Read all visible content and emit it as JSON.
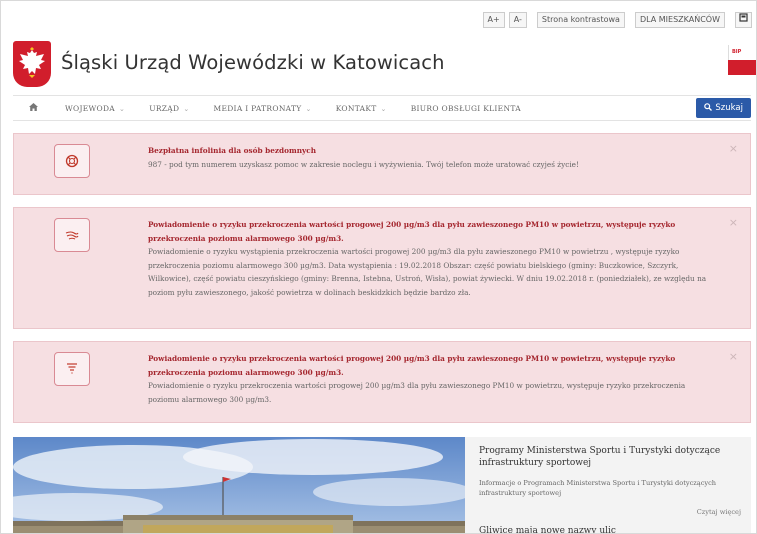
{
  "utility": {
    "font_increase": "A+",
    "font_decrease": "A-",
    "contrast_label": "Strona kontrastowa",
    "residents_label": "DLA MIESZKAŃCÓW",
    "extra_icon": "square-icon"
  },
  "header": {
    "site_title": "Śląski Urząd Wojewódzki w Katowicach",
    "crest_icon": "white-eagle-emblem-icon",
    "badge_text": "BIP"
  },
  "nav": {
    "home_icon": "home-icon",
    "items": [
      {
        "label": "WOJEWODA"
      },
      {
        "label": "URZĄD"
      },
      {
        "label": "MEDIA I PATRONATY"
      },
      {
        "label": "KONTAKT"
      },
      {
        "label": "BIURO OBSŁUGI KLIENTA"
      }
    ],
    "search_label": "Szukaj"
  },
  "alerts": [
    {
      "icon": "lifebuoy-icon",
      "title": "Bezpłatna infolinia dla osób bezdomnych",
      "body": "987 - pod tym numerem uzyskasz pomoc w zakresie noclegu i wyżywienia. Twój telefon może uratować czyjeś życie!"
    },
    {
      "icon": "wind-smog-icon",
      "title": "Powiadomienie o ryzyku przekroczenia wartości progowej 200 µg/m3 dla pyłu zawieszonego PM10 w powietrzu, występuje ryzyko przekroczenia poziomu alarmowego 300 µg/m3.",
      "body": "Powiadomienie o ryzyku wystąpienia przekroczenia wartości progowej 200 µg/m3 dla pyłu zawieszonego PM10 w powietrzu , występuje ryzyko przekroczenia poziomu alarmowego 300 µg/m3. Data wystąpienia : 19.02.2018 Obszar: część powiatu bielskiego (gminy: Buczkowice, Szczyrk, Wilkowice), część powiatu cieszyńskiego (gminy: Brenna, Istebna, Ustroń, Wisła), powiat żywiecki. W dniu 19.02.2018 r. (poniedziałek), ze względu na poziom pyłu zawieszonego, jakość powietrza w dolinach beskidzkich będzie bardzo zła."
    },
    {
      "icon": "filter-icon",
      "title": "Powiadomienie o ryzyku przekroczenia wartości progowej 200 µg/m3 dla pyłu zawieszonego PM10 w powietrzu, występuje ryzyko przekroczenia poziomu alarmowego 300 µg/m3.",
      "body": "Powiadomienie o ryzyku przekroczenia wartości progowej 200 µg/m3 dla pyłu zawieszonego PM10 w powietrzu, występuje ryzyko przekroczenia poziomu alarmowego 300 µg/m3."
    }
  ],
  "close_glyph": "×",
  "side": {
    "title": "Programy Ministerstwa Sportu i Turystyki dotyczące infrastruktury sportowej",
    "desc": "Informacje o Programach Ministerstwa Sportu i Turystyki dotyczących infrastruktury sportowej",
    "more": "Czytaj więcej",
    "next_title": "Gliwice mają nowe nazwy ulic"
  }
}
